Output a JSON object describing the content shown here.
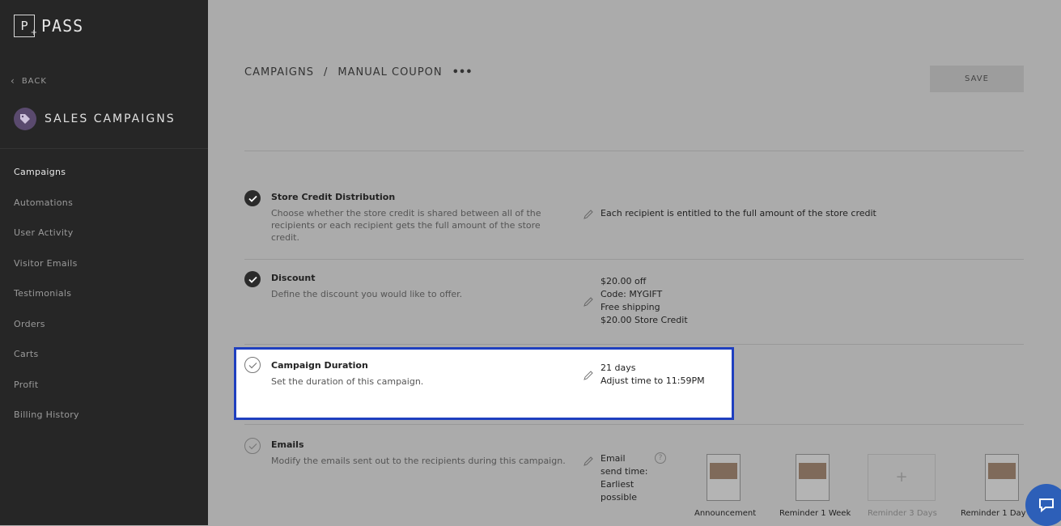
{
  "sidebar": {
    "logo_letter": "P",
    "logo_text": "PASS",
    "back_label": "BACK",
    "section_title": "SALES CAMPAIGNS",
    "items": [
      {
        "label": "Campaigns",
        "active": true
      },
      {
        "label": "Automations"
      },
      {
        "label": "User Activity"
      },
      {
        "label": "Visitor Emails"
      },
      {
        "label": "Testimonials"
      },
      {
        "label": "Orders"
      },
      {
        "label": "Carts"
      },
      {
        "label": "Profit"
      },
      {
        "label": "Billing History"
      }
    ]
  },
  "header": {
    "crumb_1": "CAMPAIGNS",
    "separator": "/",
    "crumb_2": "MANUAL COUPON",
    "more": "•••",
    "save_label": "SAVE"
  },
  "steps": {
    "store_credit": {
      "title": "Store Credit Distribution",
      "desc": "Choose whether the store credit is shared between all of the recipients or each recipient gets the full amount of the store credit.",
      "value": "Each recipient is entitled to the full amount of the store credit"
    },
    "discount": {
      "title": "Discount",
      "desc": "Define the discount you would like to offer.",
      "lines": [
        "$20.00 off",
        "Code: MYGIFT",
        "Free shipping",
        "$20.00 Store Credit"
      ]
    },
    "duration": {
      "title": "Campaign Duration",
      "desc": "Set the duration of this campaign.",
      "lines": [
        "21 days",
        "Adjust time to 11:59PM"
      ]
    },
    "emails": {
      "title": "Emails",
      "desc": "Modify the emails sent out to the recipients during this campaign.",
      "send_time": "Email send time: Earliest possible",
      "help": "?",
      "thumbs": [
        {
          "label": "Announcement"
        },
        {
          "label": "Reminder 1 Week"
        },
        {
          "label": "Reminder 3 Days",
          "add": "+"
        },
        {
          "label": "Reminder 1 Day"
        }
      ]
    }
  },
  "colors": {
    "sidebar_bg": "#262626",
    "overlay_bg": "#ababab",
    "highlight_border": "#1f3fbf",
    "tag_accent": "#5a4a6e",
    "chat_bubble": "#2d5fb8"
  }
}
